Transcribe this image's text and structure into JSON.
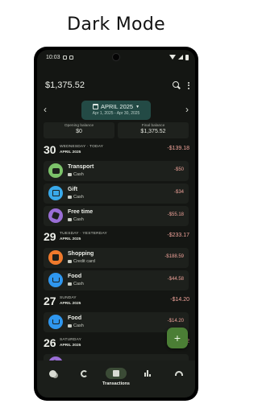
{
  "headline": "Dark Mode",
  "status": {
    "time": "10:03"
  },
  "appbar": {
    "balance": "$1,375.52",
    "search_icon": "search-icon",
    "more_icon": "more-vert-icon"
  },
  "period": {
    "title": "APRIL 2025",
    "range": "Apr 1, 2025 - Apr 30, 2025",
    "prev": "‹",
    "next": "›"
  },
  "summary": {
    "opening_label": "Opening balance",
    "opening_value": "$0",
    "final_label": "Final balance",
    "final_value": "$1,375.52"
  },
  "days": [
    {
      "num": "30",
      "name": "WEDNESDAY · TODAY",
      "month": "APRIL 2025",
      "total": "-$139.18",
      "tx": [
        {
          "category": "Transport",
          "account": "Cash",
          "amount": "-$50",
          "color": "#7cc36a",
          "icon": "bus-icon"
        },
        {
          "category": "Gift",
          "account": "Cash",
          "amount": "-$34",
          "color": "#39a9ea",
          "icon": "gift-icon"
        },
        {
          "category": "Free time",
          "account": "Cash",
          "amount": "-$55.18",
          "color": "#9a6ed6",
          "icon": "fun-icon"
        }
      ]
    },
    {
      "num": "29",
      "name": "TUESDAY · YESTERDAY",
      "month": "APRIL 2025",
      "total": "-$233.17",
      "tx": [
        {
          "category": "Shopping",
          "account": "Credit card",
          "amount": "-$188.59",
          "color": "#f07a2c",
          "icon": "shopping-bag-icon"
        },
        {
          "category": "Food",
          "account": "Cash",
          "amount": "-$44.58",
          "color": "#2f97ef",
          "icon": "cart-icon"
        }
      ]
    },
    {
      "num": "27",
      "name": "SUNDAY",
      "month": "APRIL 2025",
      "total": "-$14.20",
      "tx": [
        {
          "category": "Food",
          "account": "Cash",
          "amount": "-$14.20",
          "color": "#2f97ef",
          "icon": "cart-icon"
        }
      ]
    },
    {
      "num": "26",
      "name": "SATURDAY",
      "month": "APRIL 2025",
      "total": "-$2",
      "tx": [
        {
          "category": "",
          "account": "",
          "amount": "",
          "color": "#9a6ed6",
          "icon": "fun-icon"
        }
      ]
    }
  ],
  "fab": {
    "label": "+"
  },
  "nav": [
    {
      "label": "",
      "icon": "coins-icon",
      "active": false
    },
    {
      "label": "",
      "icon": "categories-ring-icon",
      "active": false
    },
    {
      "label": "Transactions",
      "icon": "transactions-list-icon",
      "active": true
    },
    {
      "label": "",
      "icon": "chart-bars-icon",
      "active": false
    },
    {
      "label": "",
      "icon": "gauge-icon",
      "active": false
    }
  ],
  "colors": {
    "background": "#141613",
    "card": "#1d201c",
    "accent": "#234a45",
    "negative": "#f0a39a",
    "fab": "#4b7e35"
  }
}
